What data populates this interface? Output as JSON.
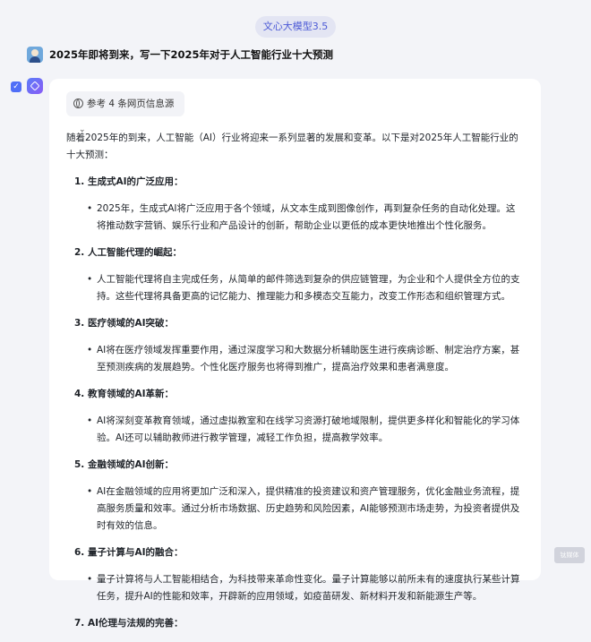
{
  "model_label": "文心大模型3.5",
  "question": "2025年即将到来，写一下2025年对于人工智能行业十大预测",
  "reference_button": {
    "label": "参考 4 条网页信息源"
  },
  "answer": {
    "intro": "随着2025年的到来，人工智能（AI）行业将迎来一系列显著的发展和变革。以下是对2025年人工智能行业的十大预测：",
    "sections": [
      {
        "title": "1. 生成式AI的广泛应用：",
        "bullet": "2025年，生成式AI将广泛应用于各个领域，从文本生成到图像创作，再到复杂任务的自动化处理。这将推动数字营销、娱乐行业和产品设计的创新，帮助企业以更低的成本更快地推出个性化服务。"
      },
      {
        "title": "2. 人工智能代理的崛起：",
        "bullet": "人工智能代理将自主完成任务，从简单的邮件筛选到复杂的供应链管理，为企业和个人提供全方位的支持。这些代理将具备更高的记忆能力、推理能力和多模态交互能力，改变工作形态和组织管理方式。"
      },
      {
        "title": "3. 医疗领域的AI突破：",
        "bullet": "AI将在医疗领域发挥重要作用，通过深度学习和大数据分析辅助医生进行疾病诊断、制定治疗方案，甚至预测疾病的发展趋势。个性化医疗服务也将得到推广，提高治疗效果和患者满意度。"
      },
      {
        "title": "4. 教育领域的AI革新：",
        "bullet": "AI将深刻变革教育领域，通过虚拟教室和在线学习资源打破地域限制，提供更多样化和智能化的学习体验。AI还可以辅助教师进行教学管理，减轻工作负担，提高教学效率。"
      },
      {
        "title": "5. 金融领域的AI创新：",
        "bullet": "AI在金融领域的应用将更加广泛和深入，提供精准的投资建议和资产管理服务，优化金融业务流程，提高服务质量和效率。通过分析市场数据、历史趋势和风险因素，AI能够预测市场走势，为投资者提供及时有效的信息。"
      },
      {
        "title": "6. 量子计算与AI的融合：",
        "bullet": "量子计算将与人工智能相结合，为科技带来革命性变化。量子计算能够以前所未有的速度执行某些计算任务，提升AI的性能和效率，开辟新的应用领域，如疫苗研发、新材料开发和新能源生产等。"
      },
      {
        "title": "7. AI伦理与法规的完善：",
        "bullet": ""
      }
    ]
  },
  "watermark": "钛媒体"
}
